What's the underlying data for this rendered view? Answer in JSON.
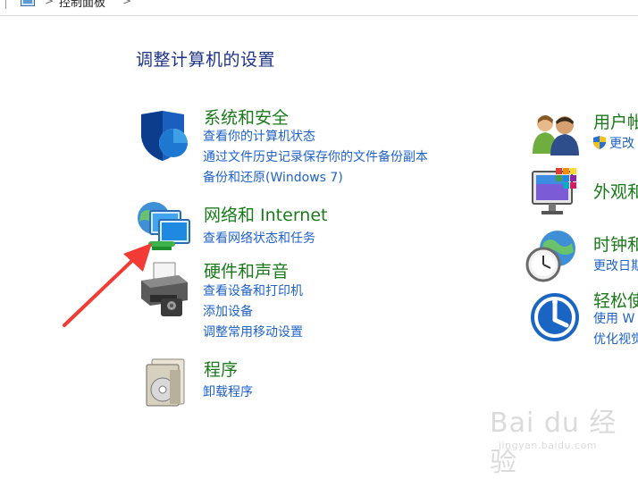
{
  "breadcrumb": {
    "sep": ">",
    "current": "控制面板"
  },
  "page_title": "调整计算机的设置",
  "left_categories": [
    {
      "title": "系统和安全",
      "icon": "shield-icon",
      "links": [
        "查看你的计算机状态",
        "通过文件历史记录保存你的文件备份副本",
        "备份和还原(Windows 7)"
      ]
    },
    {
      "title": "网络和 Internet",
      "icon": "network-icon",
      "links": [
        "查看网络状态和任务"
      ]
    },
    {
      "title": "硬件和声音",
      "icon": "printer-icon",
      "links": [
        "查看设备和打印机",
        "添加设备",
        "调整常用移动设置"
      ]
    },
    {
      "title": "程序",
      "icon": "programs-icon",
      "links": [
        "卸载程序"
      ]
    }
  ],
  "right_categories": [
    {
      "title": "用户帐",
      "icon": "users-icon",
      "links": [
        "更改"
      ]
    },
    {
      "title": "外观和",
      "icon": "appearance-icon",
      "links": []
    },
    {
      "title": "时钟和",
      "icon": "clock-globe-icon",
      "links": [
        "更改日期"
      ]
    },
    {
      "title": "轻松使",
      "icon": "ease-of-access-icon",
      "links": [
        "使用 W",
        "优化视觉"
      ]
    }
  ],
  "watermark": {
    "brand": "Bai du 经验",
    "url": "jingyan.baidu.com"
  },
  "colors": {
    "title": "#1e3287",
    "category": "#1a7a1a",
    "link": "#1f62c8",
    "arrow": "#f23b35"
  }
}
